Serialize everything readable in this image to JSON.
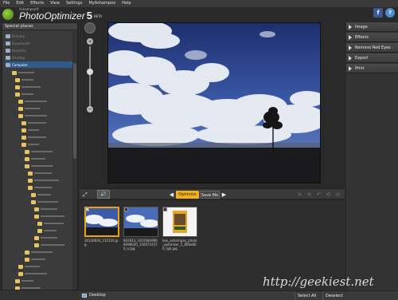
{
  "menu": [
    "File",
    "Edit",
    "Effects",
    "View",
    "Settings",
    "MyAshampoo",
    "Help"
  ],
  "app": {
    "brand": "Ashampoo®",
    "name": "PhotoOptimizer",
    "version": "5",
    "tag": "BETA"
  },
  "left_panel": {
    "title": "Special places",
    "tree": [
      {
        "label": "Pictures",
        "selected": false
      },
      {
        "label": "Documents",
        "selected": false
      },
      {
        "label": "Favorites",
        "selected": false
      },
      {
        "label": "Desktop",
        "selected": false
      },
      {
        "label": "Computer",
        "selected": true
      }
    ]
  },
  "right_panel": {
    "buttons": [
      "Image",
      "Effects",
      "Remove Red Eyes",
      "Export",
      "Print"
    ]
  },
  "toolbar": {
    "optimize": "Optimize",
    "save": "Save file",
    "prev": "◀",
    "next": "▶"
  },
  "thumbnails": [
    {
      "caption": "20120604_135116.jpg",
      "selected": true,
      "checked": true
    },
    {
      "caption": "601923_10150849966096620_1500731570_n.jpg",
      "selected": false,
      "checked": false
    },
    {
      "caption": "box_ashampoo_photo_optimizer_5_800x800_rgb.jpg",
      "selected": false,
      "checked": false
    }
  ],
  "bottom": {
    "location": "Desktop",
    "select_all": "Select All",
    "deselect": "Deselect"
  },
  "watermark": "http://geekiest.net",
  "colors": {
    "accent": "#f2b21b",
    "selection": "#2f5a8c"
  }
}
